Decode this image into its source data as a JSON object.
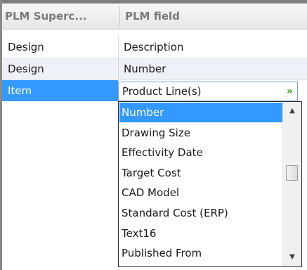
{
  "header": {
    "col1_label": "PLM Superc...",
    "col2_label": "PLM field"
  },
  "rows": [
    {
      "superclass": "Design",
      "field": "Description"
    },
    {
      "superclass": "Design",
      "field": "Number"
    },
    {
      "superclass": "Item",
      "field": "Product Line(s)"
    }
  ],
  "combo": {
    "value": "Product Line(s)",
    "chevron_icon": "double-chevron-down-icon",
    "chevron_glyph": "»",
    "chevron_color": "#3a9a2a"
  },
  "dropdown": {
    "options": [
      "Number",
      "Drawing Size",
      "Effectivity Date",
      "Target Cost",
      "CAD Model",
      "Standard Cost (ERP)",
      "Text16",
      "Published From"
    ],
    "selected_index": 0
  },
  "scrollbar": {
    "up_icon": "scroll-up-arrow-icon",
    "down_icon": "scroll-down-arrow-icon",
    "up_glyph": "▲",
    "down_glyph": "▼"
  },
  "colors": {
    "selection": "#3399ff",
    "selection_text": "#ffffff",
    "header_text": "#7a7a7a",
    "alt_row": "#eef1f7"
  }
}
